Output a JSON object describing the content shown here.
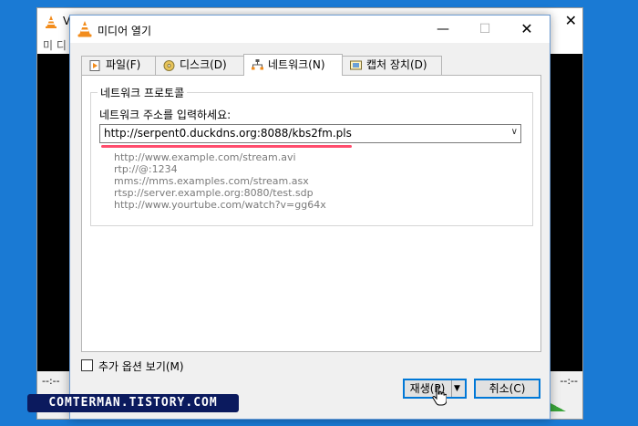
{
  "background_window": {
    "title": "V",
    "menu": "미 디",
    "close_glyph": "✕",
    "time_left": "--:--",
    "time_right": "--:--"
  },
  "dialog": {
    "title": "미디어 열기",
    "minimize_glyph": "—",
    "maximize_glyph": "☐",
    "close_glyph": "✕"
  },
  "tabs": [
    {
      "label": "파일(F)",
      "icon": "file-play-icon"
    },
    {
      "label": "디스크(D)",
      "icon": "disc-icon"
    },
    {
      "label": "네트워크(N)",
      "icon": "network-icon",
      "active": true
    },
    {
      "label": "캡처 장치(D)",
      "icon": "capture-device-icon"
    }
  ],
  "network": {
    "group_title": "네트워크 프로토콜",
    "url_label": "네트워크 주소를 입력하세요:",
    "url_value": "http://serpent0.duckdns.org:8088/kbs2fm.pls",
    "examples": [
      "http://www.example.com/stream.avi",
      "rtp://@:1234",
      "mms://mms.examples.com/stream.asx",
      "rtsp://server.example.org:8080/test.sdp",
      "http://www.yourtube.com/watch?v=gg64x"
    ]
  },
  "options": {
    "more_options_label": "추가 옵션 보기(M)",
    "checked": false
  },
  "buttons": {
    "play_label": "재생(P)",
    "play_dropdown_glyph": "▼",
    "cancel_label": "취소(C)"
  },
  "watermark": "COMTERMAN.TISTORY.COM",
  "colors": {
    "desktop": "#1a7ad4",
    "vlc_orange": "#f28c1c",
    "highlight_underline": "#ff4d6d",
    "button_focus": "#0078d7",
    "watermark_bg": "#0b1a5e"
  }
}
